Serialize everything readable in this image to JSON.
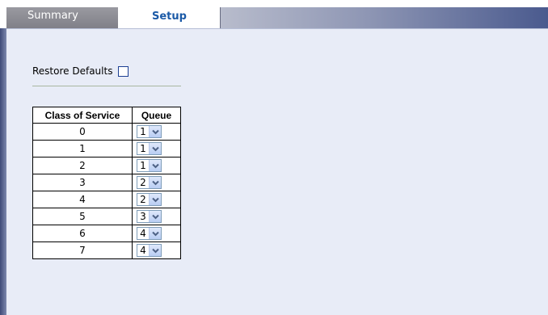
{
  "tabs": [
    {
      "label": "Summary",
      "active": false
    },
    {
      "label": "Setup",
      "active": true
    }
  ],
  "restore_defaults": {
    "label": "Restore Defaults",
    "checked": false
  },
  "table": {
    "headers": [
      "Class of Service",
      "Queue"
    ],
    "rows": [
      {
        "cos": "0",
        "queue": "1"
      },
      {
        "cos": "1",
        "queue": "1"
      },
      {
        "cos": "2",
        "queue": "1"
      },
      {
        "cos": "3",
        "queue": "2"
      },
      {
        "cos": "4",
        "queue": "2"
      },
      {
        "cos": "5",
        "queue": "3"
      },
      {
        "cos": "6",
        "queue": "4"
      },
      {
        "cos": "7",
        "queue": "4"
      }
    ]
  },
  "colors": {
    "active_tab_text": "#1b5aa7",
    "panel_bg": "#e8ecf7",
    "inactive_tab_bg": "#8a8a92"
  }
}
